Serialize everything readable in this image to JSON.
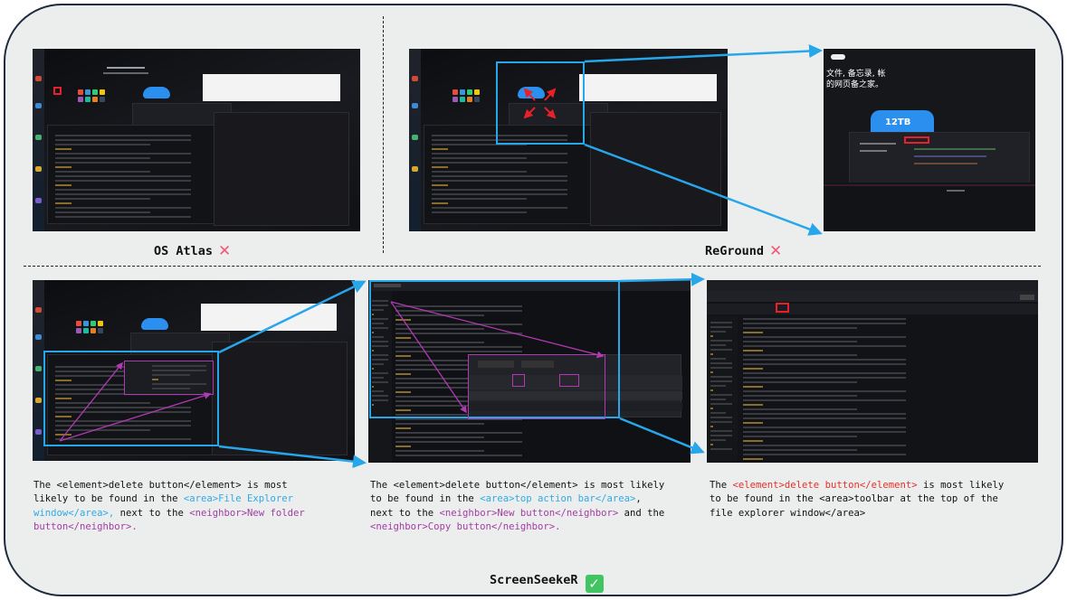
{
  "panels": {
    "os_atlas": {
      "title": "OS Atlas",
      "mark": "✕",
      "mark_icon": "red-cross-icon"
    },
    "reground": {
      "title": "ReGround",
      "mark": "✕",
      "mark_icon": "red-cross-icon"
    },
    "screenseeker": {
      "title": "ScreenSeekeR",
      "mark": "✓",
      "mark_icon": "green-check-icon"
    }
  },
  "colors": {
    "blue": "#27a6ea",
    "purple": "#b03ab3",
    "red": "#e8202a",
    "frame_border": "#1f2b3c",
    "frame_bg": "#eceeee"
  },
  "screenshot_texts": {
    "zoom_text_line1": "文件, 备忘录, 帐",
    "zoom_text_line2": "的网页备之家。",
    "cloud_label": "12TB"
  },
  "descriptions": {
    "step1": {
      "p1": "The ",
      "element": "<element>delete button</element>",
      "p2": " is most likely to be found in the ",
      "area": "<area>File Explorer window</area>,",
      "p3": " next to the ",
      "neighbor": "<neighbor>New folder button</neighbor>.",
      "p4": ""
    },
    "step2": {
      "p1": "The ",
      "element": "<element>delete button</element>",
      "p2": " is most likely to be found in the ",
      "area": "<area>top action bar</area>",
      "p3": ", next to the ",
      "neighbor1": "<neighbor>New button</neighbor>",
      "p4": " and the ",
      "neighbor2": "<neighbor>Copy button</neighbor>.",
      "p5": ""
    },
    "step3": {
      "p1": "The ",
      "element": "<element>delete button</element>",
      "p2": " is most likely to be found in the ",
      "area": "<area>toolbar at the top of the file explorer window</area>"
    }
  }
}
